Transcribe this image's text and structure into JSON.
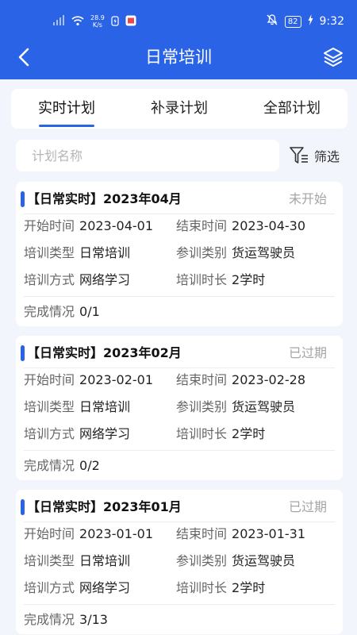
{
  "status_bar": {
    "network_speed_value": "28.9",
    "network_speed_unit": "K/s",
    "battery": "82",
    "time": "9:32"
  },
  "nav": {
    "title": "日常培训"
  },
  "tabs": [
    {
      "label": "实时计划",
      "active": true
    },
    {
      "label": "补录计划",
      "active": false
    },
    {
      "label": "全部计划",
      "active": false
    }
  ],
  "search": {
    "placeholder": "计划名称",
    "value": ""
  },
  "filter": {
    "label": "筛选"
  },
  "labels": {
    "start_time": "开始时间",
    "end_time": "结束时间",
    "training_type": "培训类型",
    "trainee_category": "参训类别",
    "training_method": "培训方式",
    "training_duration": "培训时长",
    "completion": "完成情况"
  },
  "cards": [
    {
      "title": "【日常实时】2023年04月",
      "status": "未开始",
      "start_time": "2023-04-01",
      "end_time": "2023-04-30",
      "training_type": "日常培训",
      "trainee_category": "货运驾驶员",
      "training_method": "网络学习",
      "training_duration": "2学时",
      "completion": "0/1"
    },
    {
      "title": "【日常实时】2023年02月",
      "status": "已过期",
      "start_time": "2023-02-01",
      "end_time": "2023-02-28",
      "training_type": "日常培训",
      "trainee_category": "货运驾驶员",
      "training_method": "网络学习",
      "training_duration": "2学时",
      "completion": "0/2"
    },
    {
      "title": "【日常实时】2023年01月",
      "status": "已过期",
      "start_time": "2023-01-01",
      "end_time": "2023-01-31",
      "training_type": "日常培训",
      "trainee_category": "货运驾驶员",
      "training_method": "网络学习",
      "training_duration": "2学时",
      "completion": "3/13"
    }
  ],
  "colors": {
    "brand": "#2a63e6",
    "background": "#f2f5fb",
    "status_text": "#a5a5a5"
  },
  "icons": {
    "back": "chevron-left-icon",
    "layers": "layers-icon",
    "filter": "filter-icon"
  }
}
